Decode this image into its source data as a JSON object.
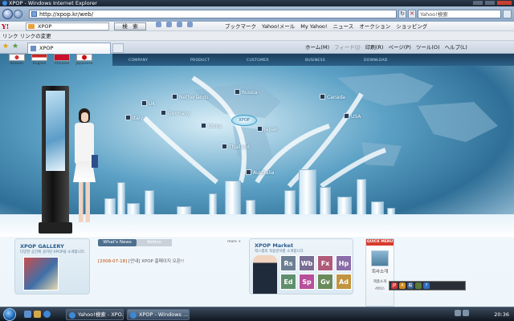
{
  "window": {
    "title": "XPOP - Windows Internet Explorer"
  },
  "address": {
    "url": "http://xpop.kr/web/",
    "search_placeholder": "Yahoo!検索"
  },
  "yahoo_toolbar": {
    "logo": "Y!",
    "search_value": "XPOP",
    "search_button": "検　索",
    "items": [
      "ブックマーク",
      "Yahoo!メール",
      "My Yahoo!",
      "ニュース",
      "オークション",
      "ショッピング"
    ]
  },
  "links_bar": {
    "label": "リンク",
    "item": "リンクの変更"
  },
  "tabs": {
    "active": "XPOP"
  },
  "command_bar": {
    "home": "ホーム(M)",
    "feeds": "フィード(J)",
    "print": "印刷(R)",
    "page": "ページ(P)",
    "tools": "ツール(O)",
    "help": "ヘルプ(L)"
  },
  "site": {
    "languages": [
      "Korean",
      "English",
      "Chinese",
      "Japanese"
    ],
    "nav": [
      "COMPANY",
      "PRODUCT",
      "CUSTOMER",
      "BUSINESS",
      "DOWNLOAD"
    ],
    "cities": [
      "UK",
      "Netherlands",
      "Russia",
      "Canada",
      "Italy",
      "Germany",
      "China",
      "Japan",
      "USA",
      "Thailand",
      "Australia"
    ],
    "hub": "XPOP",
    "gallery": {
      "title": "XPOP GALLERY",
      "subtitle": "다양한 공간에 설치된 XPOP을 소개합니다."
    },
    "news": {
      "tab_news": "What's News",
      "tab_notice": "Notice",
      "more": "more +",
      "date": "[2008-07-18]",
      "text": "[안내] XPOP 홈페이지 오픈!!"
    },
    "market": {
      "title": "XPOP Market",
      "subtitle": "맥스랩의 적용분야를 소개합니다.",
      "tiles": [
        "Rs",
        "Wb",
        "Fx",
        "Hp",
        "Ed",
        "Sp",
        "Gv",
        "Ad"
      ]
    },
    "quick": {
      "title": "QUICK MENU",
      "item": "회사소개",
      "sub1": "제품소개",
      "sub2": "서비스"
    }
  },
  "taskbar": {
    "items": [
      "Yahoo!検索 - XPO...",
      "XPOP - Windows ..."
    ],
    "clock": "20:36",
    "ime": [
      "JP",
      "A",
      "般"
    ]
  }
}
